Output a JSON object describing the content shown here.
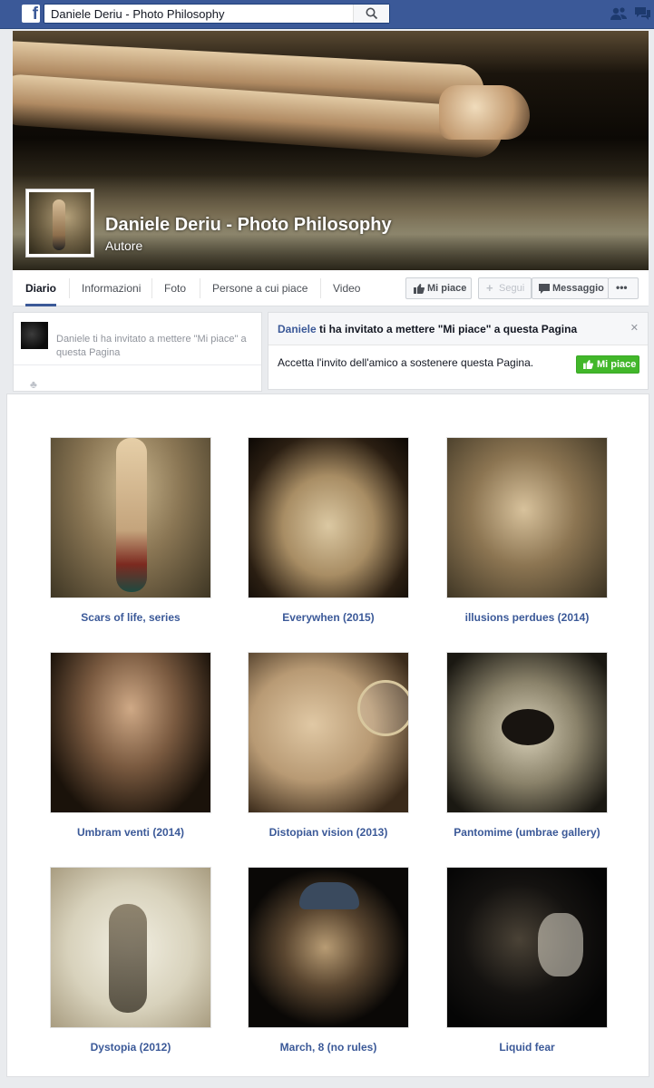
{
  "browser": {
    "search_value": "Daniele Deriu - Photo Philosophy",
    "logo_letter": "f"
  },
  "page": {
    "name": "Daniele Deriu - Photo Philosophy",
    "category": "Autore"
  },
  "tabs": [
    {
      "label": "Diario",
      "active": true
    },
    {
      "label": "Informazioni",
      "active": false
    },
    {
      "label": "Foto",
      "active": false
    },
    {
      "label": "Persone a cui piace",
      "active": false
    },
    {
      "label": "Video",
      "active": false
    }
  ],
  "actions": {
    "like": "Mi piace",
    "follow": "Segui",
    "message": "Messaggio",
    "more": "•••"
  },
  "invite_left": {
    "text": "Daniele ti ha invitato a mettere \"Mi piace\" a questa Pagina"
  },
  "invite_card": {
    "name": "Daniele",
    "title_rest": " ti ha invitato a mettere \"Mi piace\" a questa Pagina",
    "body": "Accetta l'invito dell'amico a sostenere questa Pagina.",
    "button": "Mi piace",
    "close": "✕"
  },
  "gallery": [
    {
      "caption": "Scars of life, series"
    },
    {
      "caption": "Everywhen (2015)"
    },
    {
      "caption": "illusions perdues (2014)"
    },
    {
      "caption": "Umbram venti (2014)"
    },
    {
      "caption": "Distopian vision (2013)"
    },
    {
      "caption": "Pantomime (umbrae gallery)"
    },
    {
      "caption": "Dystopia (2012)"
    },
    {
      "caption": "March, 8 (no rules)"
    },
    {
      "caption": "Liquid fear"
    }
  ],
  "colors": {
    "brand": "#3b5998",
    "like_green": "#42b72a"
  }
}
